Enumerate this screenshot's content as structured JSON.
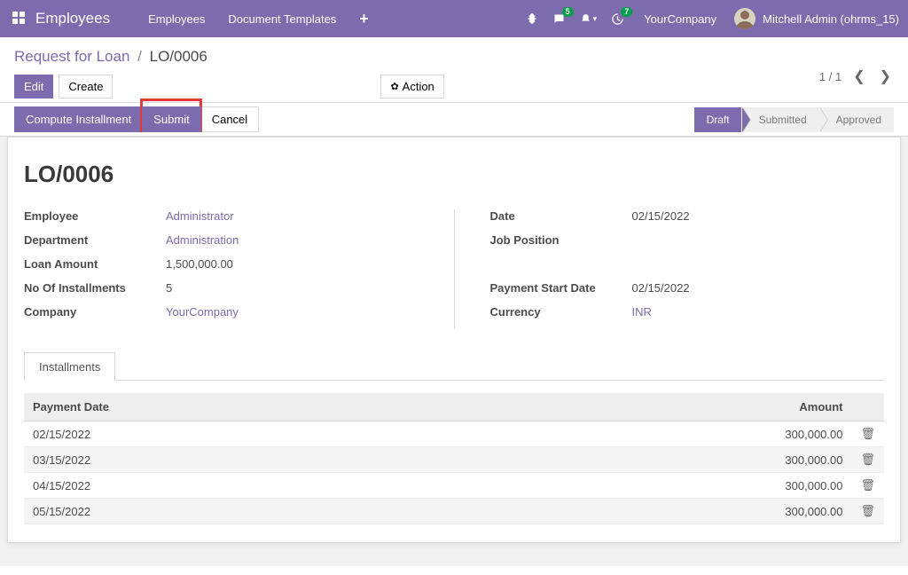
{
  "nav": {
    "app_name": "Employees",
    "links": [
      "Employees",
      "Document Templates"
    ],
    "msg_badge": "5",
    "clock_badge": "7",
    "company": "YourCompany",
    "user_name": "Mitchell Admin (ohrms_15)"
  },
  "crumbs": {
    "parent": "Request for Loan",
    "current": "LO/0006"
  },
  "buttons": {
    "edit": "Edit",
    "create": "Create",
    "action": "Action"
  },
  "pager": {
    "text": "1 / 1"
  },
  "action_row": {
    "compute": "Compute Installment",
    "submit": "Submit",
    "cancel": "Cancel"
  },
  "status": {
    "steps": [
      "Draft",
      "Submitted",
      "Approved"
    ],
    "active_index": 0
  },
  "record": {
    "title": "LO/0006",
    "left_fields": [
      {
        "label": "Employee",
        "value": "Administrator",
        "link": true
      },
      {
        "label": "Department",
        "value": "Administration",
        "link": true
      },
      {
        "label": "Loan Amount",
        "value": "1,500,000.00",
        "link": false
      },
      {
        "label": "No Of Installments",
        "value": "5",
        "link": false
      },
      {
        "label": "Company",
        "value": "YourCompany",
        "link": true
      }
    ],
    "right_fields": [
      {
        "label": "Date",
        "value": "02/15/2022",
        "link": false
      },
      {
        "label": "Job Position",
        "value": "",
        "link": false
      },
      {
        "label": "",
        "value": "",
        "link": false
      },
      {
        "label": "Payment Start Date",
        "value": "02/15/2022",
        "link": false
      },
      {
        "label": "Currency",
        "value": "INR",
        "link": true
      }
    ]
  },
  "tabs": {
    "installments": "Installments"
  },
  "table": {
    "headers": {
      "date": "Payment Date",
      "amount": "Amount"
    },
    "rows": [
      {
        "date": "02/15/2022",
        "amount": "300,000.00"
      },
      {
        "date": "03/15/2022",
        "amount": "300,000.00"
      },
      {
        "date": "04/15/2022",
        "amount": "300,000.00"
      },
      {
        "date": "05/15/2022",
        "amount": "300,000.00"
      }
    ]
  }
}
